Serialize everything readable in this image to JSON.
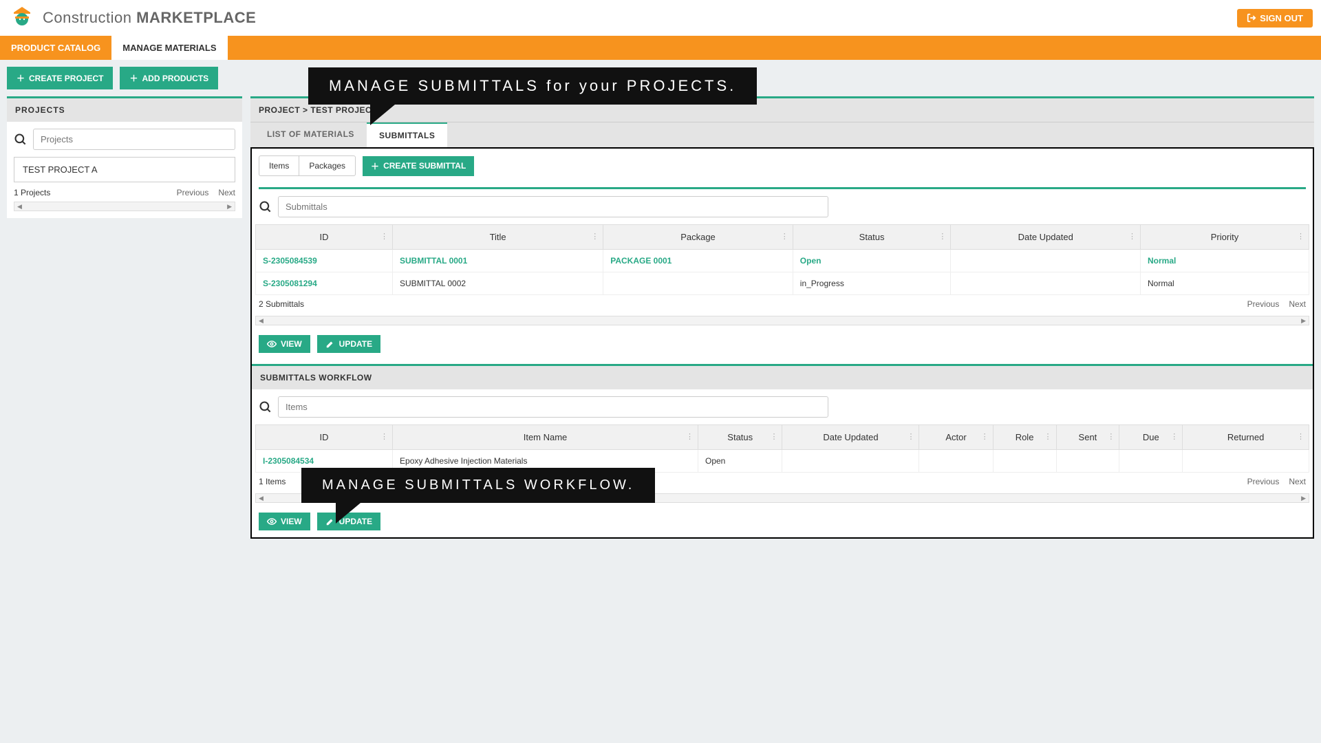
{
  "header": {
    "brand_prefix": "Construction ",
    "brand_bold": "MARKETPLACE",
    "signout": "SIGN OUT"
  },
  "nav": {
    "product_catalog": "PRODUCT CATALOG",
    "manage_materials": "MANAGE MATERIALS"
  },
  "buttons": {
    "create_project": "CREATE PROJECT",
    "add_products": "ADD PRODUCTS",
    "create_submittal": "CREATE SUBMITTAL",
    "view": "VIEW",
    "update": "UPDATE"
  },
  "sidebar": {
    "title": "PROJECTS",
    "search_placeholder": "Projects",
    "project_name": "TEST PROJECT A",
    "count": "1 Projects",
    "previous": "Previous",
    "next": "Next"
  },
  "main": {
    "breadcrumb": "PROJECT > TEST PROJECT A",
    "tab_list": "LIST OF MATERIALS",
    "tab_submittals": "SUBMITTALS",
    "toggle_items": "Items",
    "toggle_packages": "Packages",
    "submittals_search_placeholder": "Submittals",
    "submittals_columns": {
      "id": "ID",
      "title": "Title",
      "package": "Package",
      "status": "Status",
      "date_updated": "Date Updated",
      "priority": "Priority"
    },
    "submittals_rows": [
      {
        "id": "S-2305084539",
        "title": "SUBMITTAL 0001",
        "package": "PACKAGE 0001",
        "status": "Open",
        "date_updated": "",
        "priority": "Normal",
        "highlighted": true
      },
      {
        "id": "S-2305081294",
        "title": "SUBMITTAL 0002",
        "package": "",
        "status": "in_Progress",
        "date_updated": "",
        "priority": "Normal",
        "highlighted": false
      }
    ],
    "submittals_count": "2 Submittals",
    "workflow_title": "SUBMITTALS WORKFLOW",
    "items_search_placeholder": "Items",
    "workflow_columns": {
      "id": "ID",
      "item_name": "Item Name",
      "status": "Status",
      "date_updated": "Date Updated",
      "actor": "Actor",
      "role": "Role",
      "sent": "Sent",
      "due": "Due",
      "returned": "Returned"
    },
    "workflow_rows": [
      {
        "id": "I-2305084534",
        "item_name": "Epoxy Adhesive Injection Materials",
        "status": "Open"
      }
    ],
    "workflow_count": "1 Items",
    "previous": "Previous",
    "next": "Next"
  },
  "callouts": {
    "c1": "MANAGE SUBMITTALS for your PROJECTS.",
    "c2": "MANAGE SUBMITTALS WORKFLOW."
  }
}
